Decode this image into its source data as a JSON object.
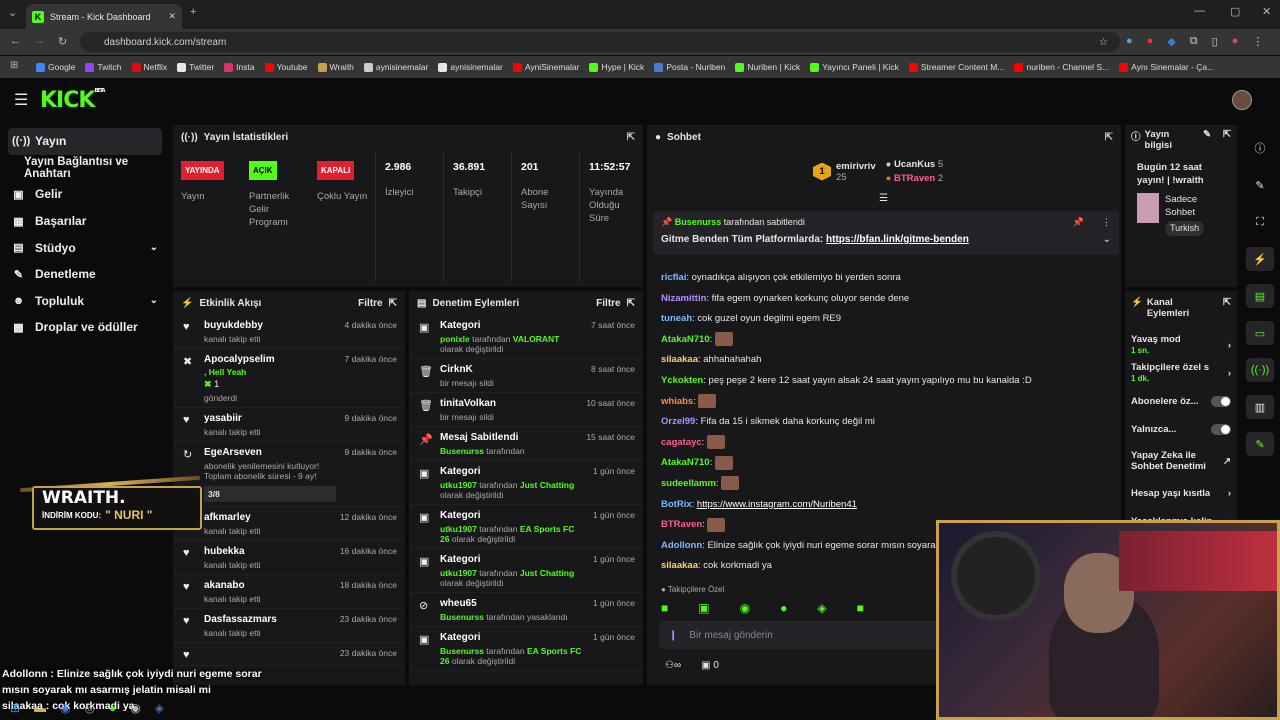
{
  "browser": {
    "tab_title": "Stream - Kick Dashboard",
    "url": "dashboard.kick.com/stream",
    "bookmarks": [
      {
        "label": "Google",
        "color": "#4285f4"
      },
      {
        "label": "Twitch",
        "color": "#9146ff"
      },
      {
        "label": "Netflix",
        "color": "#e50914"
      },
      {
        "label": "Twitter",
        "color": "#e6e6e6"
      },
      {
        "label": "Insta",
        "color": "#e1306c"
      },
      {
        "label": "Youtube",
        "color": "#ff0000"
      },
      {
        "label": "Wraith",
        "color": "#c8a24a"
      },
      {
        "label": "aynisinemalar",
        "color": "#cccccc"
      },
      {
        "label": "aynisinemalar",
        "color": "#e6e6e6"
      },
      {
        "label": "AyniSinemalar",
        "color": "#ff0000"
      },
      {
        "label": "Hype | Kick",
        "color": "#53fc18"
      },
      {
        "label": "Posta - Nuriben",
        "color": "#4a7bd0"
      },
      {
        "label": "Nuriben | Kick",
        "color": "#53fc18"
      },
      {
        "label": "Yayıncı Paneli | Kick",
        "color": "#53fc18"
      },
      {
        "label": "Streamer Content M...",
        "color": "#ff0000"
      },
      {
        "label": "nuriben - Channel S...",
        "color": "#ff0000"
      },
      {
        "label": "Aynı Sinemalar - Ça...",
        "color": "#ff0000"
      }
    ]
  },
  "brand": {
    "logo": "KICK",
    "beta": "BETA",
    "accent": "#53fc18"
  },
  "sidebar": {
    "items": [
      {
        "label": "Yayın",
        "icon": "broadcast-icon"
      },
      {
        "label": "Yayın Bağlantısı ve Anahtarı",
        "icon": ""
      },
      {
        "label": "Gelir",
        "icon": "wallet-icon"
      },
      {
        "label": "Başarılar",
        "icon": "trophy-icon"
      },
      {
        "label": "Stüdyo",
        "icon": "studio-icon"
      },
      {
        "label": "Denetleme",
        "icon": "wrench-icon"
      },
      {
        "label": "Topluluk",
        "icon": "people-icon"
      },
      {
        "label": "Droplar ve ödüller",
        "icon": "gift-icon"
      }
    ]
  },
  "stats": {
    "title": "Yayın İstatistikleri",
    "status": [
      {
        "badge": "YAYINDA",
        "label": "Yayın"
      },
      {
        "badge": "AÇIK",
        "label": "Partnerlik Gelir Programı"
      },
      {
        "badge": "KAPALI",
        "label": "Çoklu Yayın"
      }
    ],
    "metrics": [
      {
        "value": "2.986",
        "label": "İzleyici"
      },
      {
        "value": "36.891",
        "label": "Takipçi"
      },
      {
        "value": "201",
        "label": "Abone Sayısı"
      },
      {
        "value": "11:52:57",
        "label": "Yayında Olduğu Süre"
      }
    ]
  },
  "activity": {
    "title": "Etkinlik Akışı",
    "filter": "Filtre",
    "items": [
      {
        "name": "buyukdebby",
        "sub": "kanalı takip etti",
        "time": "4 dakika önce"
      },
      {
        "name": "Apocalypselim",
        "sub": "gönderdi",
        "extra": ", Hell Yeah",
        "amount": "1",
        "time": "7 dakika önce"
      },
      {
        "name": "yasabiir",
        "sub": "kanalı takip etti",
        "time": "9 dakika önce"
      },
      {
        "name": "EgeArseven",
        "sub": "abonelik yenilemesini kutluyor! Toplam abonelik süresi - 9 ay!",
        "progress": "3/8",
        "time": "9 dakika önce"
      },
      {
        "name": "afkmarley",
        "sub": "kanalı takip etti",
        "time": "12 dakika önce"
      },
      {
        "name": "hubekka",
        "sub": "kanalı takip etti",
        "time": "16 dakika önce"
      },
      {
        "name": "akanabo",
        "sub": "kanalı takip etti",
        "time": "18 dakika önce"
      },
      {
        "name": "Dasfassazmars",
        "sub": "kanalı takip etti",
        "time": "23 dakika önce"
      },
      {
        "name": "",
        "sub": "",
        "time": "23 dakika önce"
      }
    ]
  },
  "moderation": {
    "title": "Denetim Eylemleri",
    "filter": "Filtre",
    "items": [
      {
        "name": "Kategori",
        "user": "ponixle",
        "mid": " tarafından ",
        "target": "VALORANT",
        "tail": " olarak değiştirildi",
        "time": "7 saat önce"
      },
      {
        "name": "CirknK",
        "plain": "bir mesajı sildi",
        "time": "8 saat önce"
      },
      {
        "name": "tinitaVolkan",
        "plain": "bir mesajı sildi",
        "time": "10 saat önce"
      },
      {
        "name": "Mesaj Sabitlendi",
        "user": "Busenurss",
        "mid": " tarafından",
        "target": "",
        "tail": "",
        "time": "15 saat önce"
      },
      {
        "name": "Kategori",
        "user": "utku1907",
        "mid": " tarafından ",
        "target": "Just Chatting",
        "tail": " olarak değiştirildi",
        "time": "1 gün önce"
      },
      {
        "name": "Kategori",
        "user": "utku1907",
        "mid": " tarafından ",
        "target": "EA Sports FC 26",
        "tail": " olarak değiştirildi",
        "time": "1 gün önce"
      },
      {
        "name": "Kategori",
        "user": "utku1907",
        "mid": " tarafından ",
        "target": "Just Chatting",
        "tail": " olarak değiştirildi",
        "time": "1 gün önce"
      },
      {
        "name": "wheu65",
        "user": "Busenurss",
        "mid": " tarafından yasaklandı",
        "target": "",
        "tail": "",
        "time": "1 gün önce"
      },
      {
        "name": "Kategori",
        "user": "Busenurss",
        "mid": " tarafından ",
        "target": "EA Sports FC 26",
        "tail": " olarak değiştirildi",
        "time": "1 gün önce"
      }
    ]
  },
  "chat": {
    "title": "Sohbet",
    "top": [
      {
        "name": "emirivriv",
        "count": "25",
        "rank": "1"
      },
      {
        "name": "UcanKus",
        "count": "5"
      },
      {
        "name": "BTRaven",
        "count": "2"
      }
    ],
    "pinned": {
      "by": "Busenurss",
      "by_suffix": " tarafından sabitlendi",
      "text": "Gitme Benden Tüm Platformlarda: ",
      "link": "https://bfan.link/gitme-benden"
    },
    "messages": [
      {
        "user": "ricflai",
        "color": "#7db9ff",
        "text": "oynadıkça alışıyon çok etkilemiyo bi yerden sonra"
      },
      {
        "user": "Nizamittin",
        "color": "#b58cff",
        "text": "fifa egem oynarken korkunç oluyor sende dene"
      },
      {
        "user": "tuneah",
        "color": "#7db9ff",
        "text": "cok guzel oyun degilmi egem RE9"
      },
      {
        "user": "AtakaN710",
        "color": "#53fc18",
        "text": "",
        "emote": true
      },
      {
        "user": "silaakaa",
        "color": "#ffd166",
        "text": "ahhahahahah"
      },
      {
        "user": "Yckokten",
        "color": "#53fc18",
        "text": "peş peşe 2 kere 12 saat yayın alsak 24 saat yayın yapılıyo mu bu kanalda :D"
      },
      {
        "user": "whiabs",
        "color": "#ff8c42",
        "text": "",
        "emote": true
      },
      {
        "user": "Orzel99",
        "color": "#b58cff",
        "text": "Fifa da 15 i sikmek daha korkunç değil mi"
      },
      {
        "user": "cagatayc",
        "color": "#ff5d8f",
        "text": "",
        "emote": true
      },
      {
        "user": "AtakaN710",
        "color": "#53fc18",
        "text": "",
        "emote": true
      },
      {
        "user": "sudeellamm",
        "color": "#53fc18",
        "text": "",
        "emote": true
      },
      {
        "user": "BotRix",
        "color": "#7db9ff",
        "text": "",
        "link": "https://www.instagram.com/Nuriben41"
      },
      {
        "user": "BTRaven",
        "color": "#ff5d8f",
        "text": "",
        "emote": true
      },
      {
        "user": "Adollonn",
        "color": "#7db9ff",
        "text": "Elinize sağlık çok iyiydi nuri egeme sorar mısın soyarak m"
      },
      {
        "user": "silaakaa",
        "color": "#ffd166",
        "text": "cok korkmadi ya"
      }
    ],
    "mode": "Takipçilere Özel",
    "input_placeholder": "Bir mesaj gönderin",
    "points": "0"
  },
  "stream_info": {
    "title": "Yayın bilgisi",
    "stream_title": "Bugün 12 saat yayın! | !wraith",
    "category": "Sadece Sohbet",
    "language": "Turkish"
  },
  "channel_actions": {
    "title": "Kanal Eylemleri",
    "items": [
      {
        "label": "Yavaş mod",
        "sub": "1 sn."
      },
      {
        "label": "Takipçilere özel s",
        "sub": "1 dk."
      },
      {
        "label": "Abonelere öz...",
        "sub": ""
      },
      {
        "label": "Yalnızca...",
        "sub": ""
      },
      {
        "label": "Yapay Zeka ile Sohbet Denetimi",
        "sub": ""
      },
      {
        "label": "Hesap yaşı kısıtla",
        "sub": ""
      },
      {
        "label": "Yasaklanmış kelin",
        "sub": ""
      }
    ]
  },
  "overlay": {
    "sponsor": "WRAITH.",
    "code_label": "İNDİRİM KODU:",
    "code": "\" NURI \"",
    "chat1": "Adollonn : Elinize sağlık çok iyiydi nuri egeme sorar mısın soyarak mı asarmış jelatin misali mi",
    "chat2": "silaakaa : cok korkmadi ya",
    "webcam_frame": "#c8a24a"
  }
}
